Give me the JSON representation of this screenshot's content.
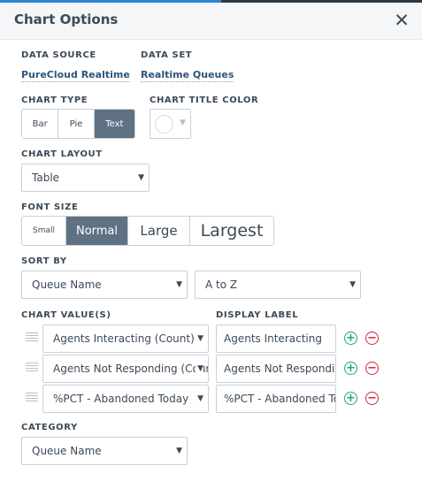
{
  "dialog": {
    "title": "Chart Options",
    "close_icon": "close-icon"
  },
  "data_source": {
    "label": "DATA SOURCE",
    "value": "PureCloud Realtime"
  },
  "data_set": {
    "label": "DATA SET",
    "value": "Realtime Queues"
  },
  "chart_type": {
    "label": "CHART TYPE",
    "options": [
      "Bar",
      "Pie",
      "Text"
    ],
    "selected": "Text"
  },
  "chart_title_color": {
    "label": "CHART TITLE COLOR",
    "value_color": "#ffffff"
  },
  "chart_layout": {
    "label": "CHART LAYOUT",
    "value": "Table"
  },
  "font_size": {
    "label": "FONT SIZE",
    "options": [
      "Small",
      "Normal",
      "Large",
      "Largest"
    ],
    "selected": "Normal"
  },
  "sort_by": {
    "label": "SORT BY",
    "field": "Queue Name",
    "order": "A to Z"
  },
  "chart_values": {
    "label": "CHART VALUE(S)",
    "display_label_header": "DISPLAY LABEL",
    "rows": [
      {
        "value": "Agents Interacting (Count)",
        "display_label": "Agents Interacting"
      },
      {
        "value": "Agents Not Responding (Count)",
        "display_label": "Agents Not Responding"
      },
      {
        "value": "%PCT - Abandoned Today",
        "display_label": "%PCT - Abandoned Today"
      }
    ]
  },
  "category": {
    "label": "CATEGORY",
    "value": "Queue Name"
  },
  "colors": {
    "accent": "#2a86d1",
    "selected_segment": "#5f7284",
    "add": "#20a86b",
    "remove": "#d0273a"
  }
}
